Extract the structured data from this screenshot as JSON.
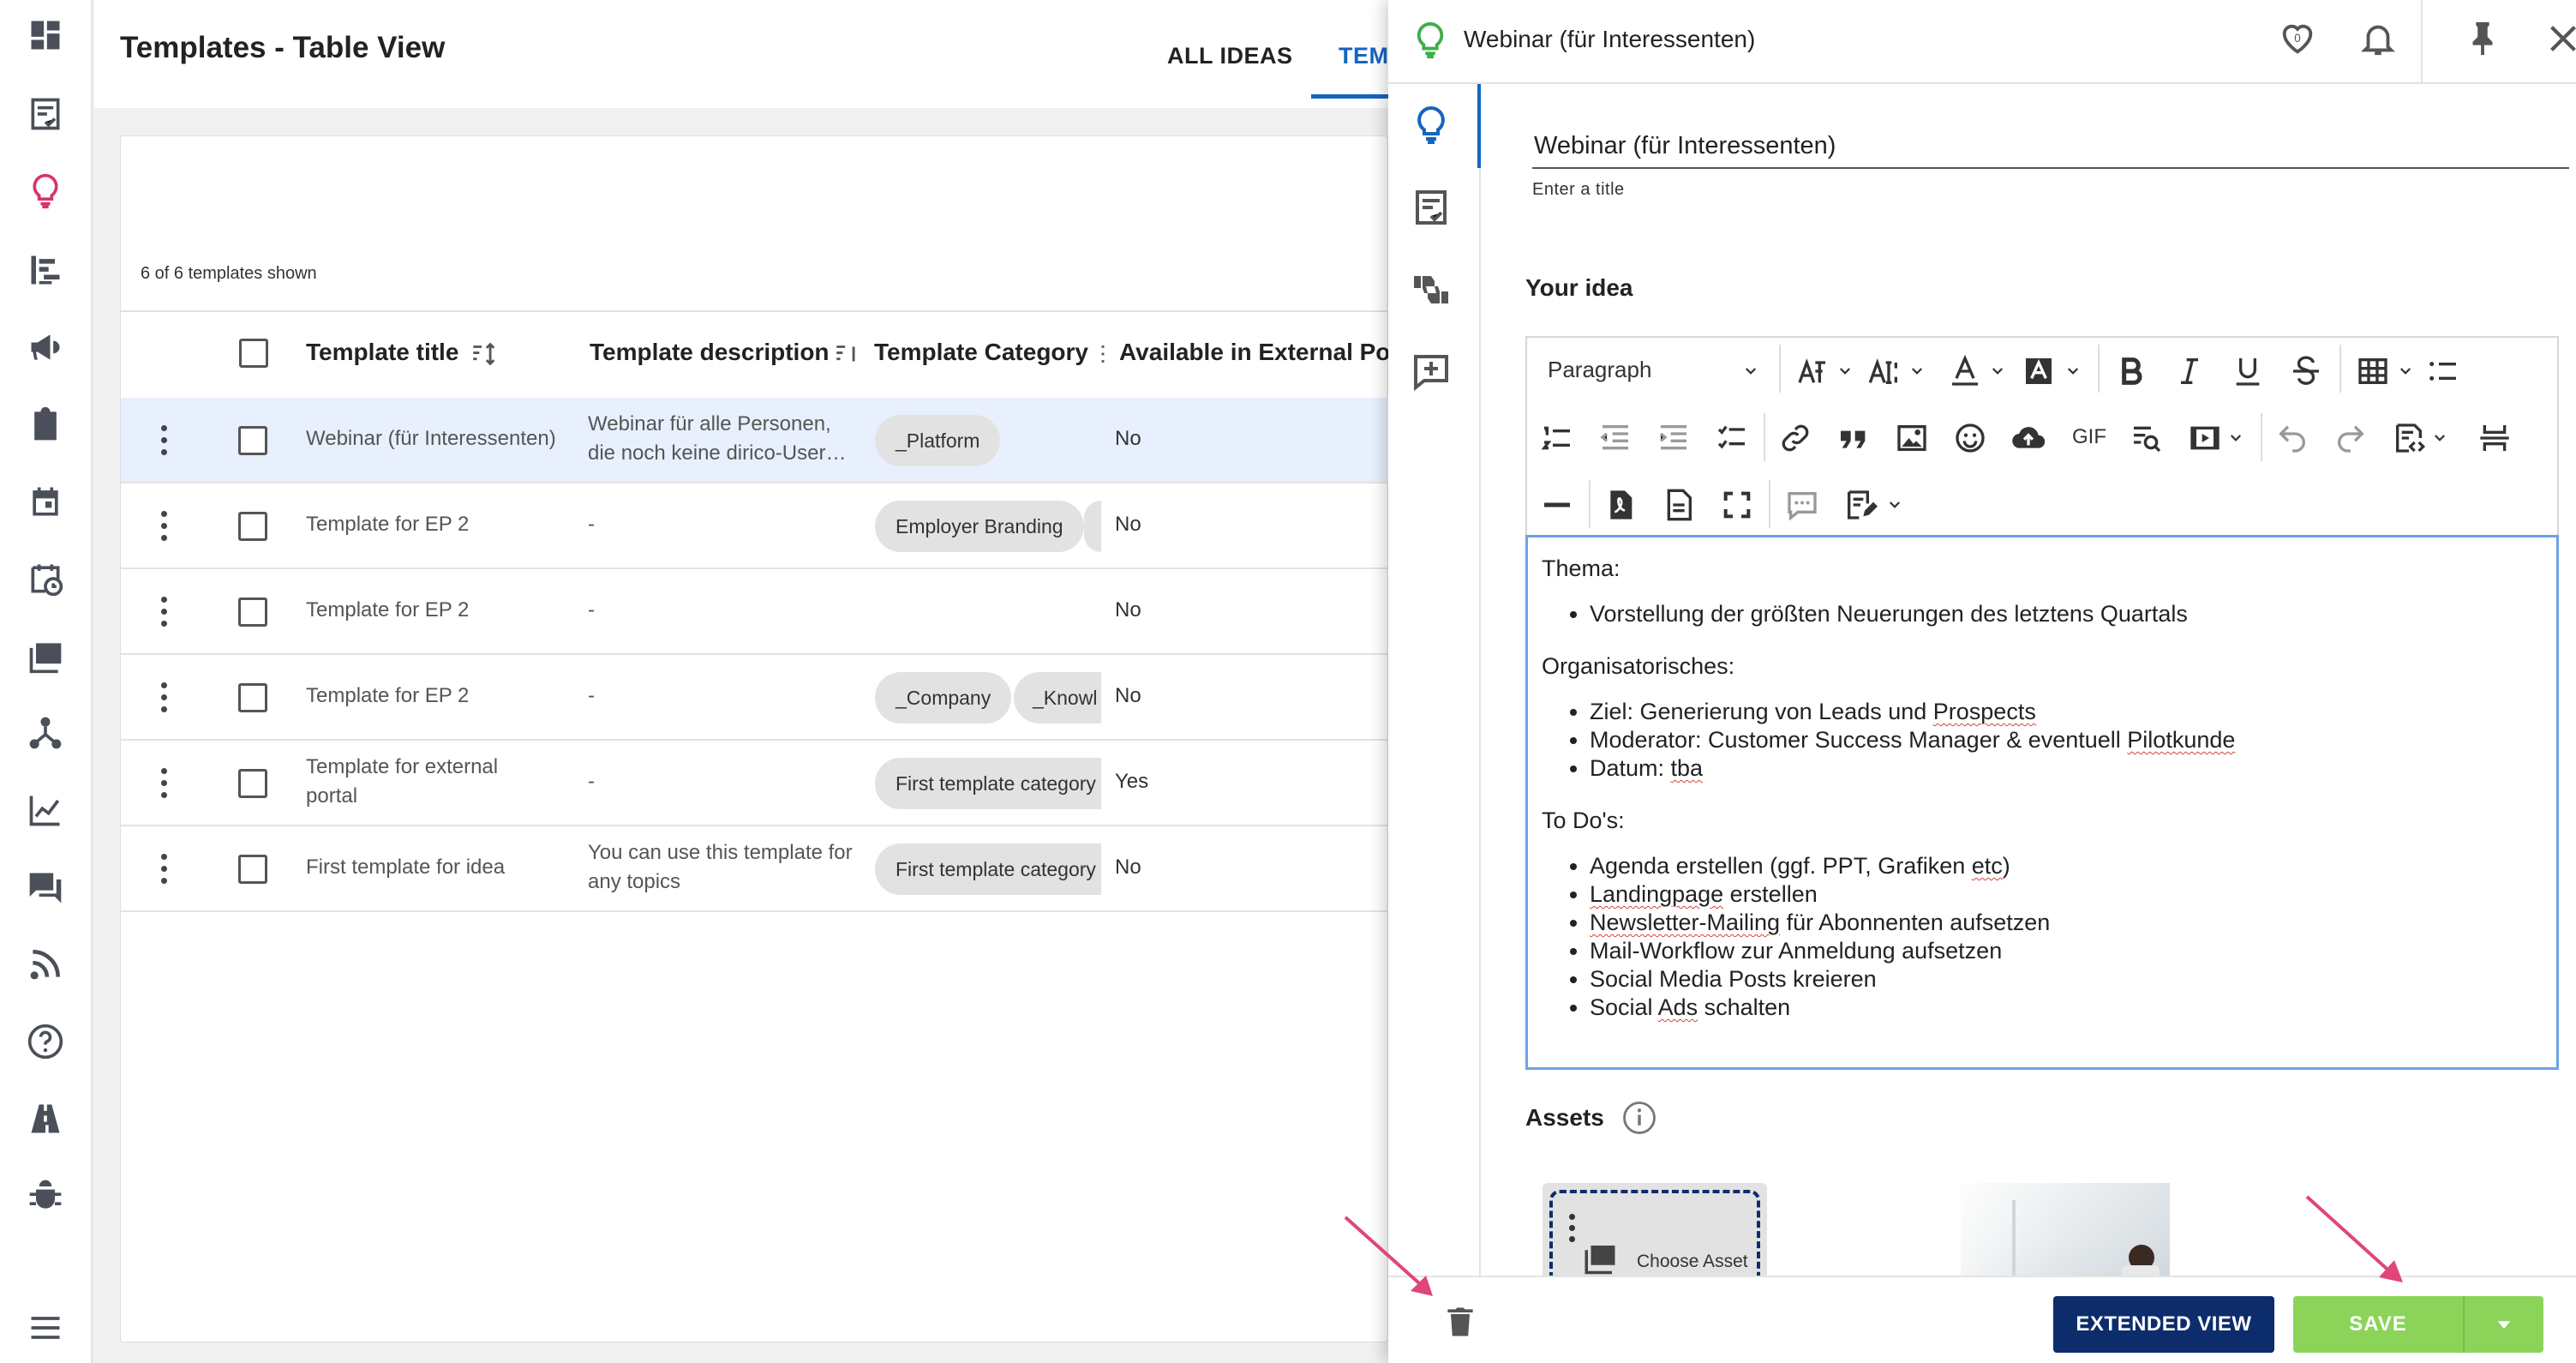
{
  "app": {
    "page_title": "Templates - Table View",
    "tabs": [
      {
        "label": "ALL IDEAS",
        "active": false
      },
      {
        "label": "TEM",
        "active": true
      }
    ],
    "accent_color": "#1565c0",
    "brand_dark": "#0d2c6b",
    "save_color": "#8bd459"
  },
  "rail": {
    "icons": [
      "dashboard-icon",
      "tasks-icon",
      "lightbulb-icon",
      "tree-icon",
      "megaphone-icon",
      "clipboard-icon",
      "calendar-icon",
      "calendar-clock-icon",
      "images-icon",
      "network-icon",
      "chart-icon",
      "chat-icon",
      "rss-icon",
      "help-icon",
      "road-icon",
      "bug-icon",
      "menu-icon"
    ],
    "active": "lightbulb-icon"
  },
  "table": {
    "count_text": "6 of 6 templates shown",
    "columns": [
      "Template title",
      "Template description",
      "Template Category",
      "Available in External Port"
    ],
    "rows": [
      {
        "title": "Webinar (für Interessenten)",
        "description": "Webinar für alle Personen, die noch keine dirico-User…",
        "chips": [
          "_Platform"
        ],
        "available": "No",
        "selected": true
      },
      {
        "title": "Template for EP 2",
        "description": "-",
        "chips": [
          "Employer Branding",
          ""
        ],
        "available": "No",
        "selected": false
      },
      {
        "title": "Template for EP 2",
        "description": "-",
        "chips": [],
        "available": "No",
        "selected": false
      },
      {
        "title": "Template for EP 2",
        "description": "-",
        "chips": [
          "_Company",
          "_Knowl"
        ],
        "available": "No",
        "selected": false
      },
      {
        "title": "Template for external portal",
        "description": "-",
        "chips": [
          "First template category"
        ],
        "available": "Yes",
        "selected": false
      },
      {
        "title": "First template for idea",
        "description": "You can use this template for any topics",
        "chips": [
          "First template category"
        ],
        "available": "No",
        "selected": false
      }
    ]
  },
  "panel": {
    "header_title": "Webinar (für Interessenten)",
    "favorite_count": "0",
    "title_value": "Webinar (für Interessenten)",
    "title_helper": "Enter a title",
    "idea_label": "Your idea",
    "toolbar": {
      "paragraph_label": "Paragraph",
      "gif_label": "GIF"
    },
    "editor": {
      "thema_heading": "Thema:",
      "thema_items": [
        "Vorstellung der größten Neuerungen des letztens Quartals"
      ],
      "org_heading": "Organisatorisches:",
      "org_item1_pre": "Ziel: Generierung von Leads und ",
      "org_item1_wavy": "Prospects",
      "org_item2_pre": "Moderator: Customer Success Manager & eventuell ",
      "org_item2_wavy": "Pilotkunde",
      "org_item3_pre": "Datum: ",
      "org_item3_wavy": "tba",
      "todo_heading": "To Do's:",
      "todo_item1_pre": "Agenda erstellen (ggf. PPT, Grafiken ",
      "todo_item1_wavy": "etc",
      "todo_item1_post": ")",
      "todo_item2_wavy": "Landingpage",
      "todo_item2_post": " erstellen",
      "todo_item3_wavy": "Newsletter-Mailing",
      "todo_item3_post": " für Abonnenten aufsetzen",
      "todo_item4": "Mail-Workflow zur Anmeldung aufsetzen",
      "todo_item5": "Social Media Posts kreieren",
      "todo_item6_pre": "Social ",
      "todo_item6_wavy": "Ads",
      "todo_item6_post": " schalten"
    },
    "assets_label": "Assets",
    "asset_choose_label": "Choose Asset",
    "buttons": {
      "extended_view": "EXTENDED VIEW",
      "save": "SAVE"
    }
  }
}
